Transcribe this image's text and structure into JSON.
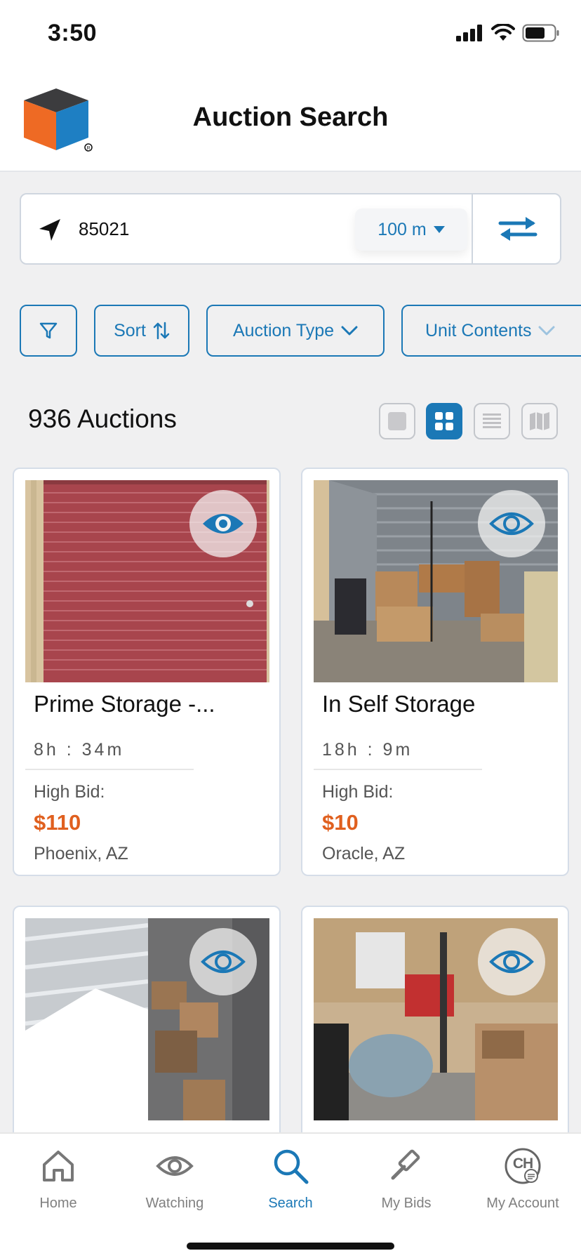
{
  "status_bar": {
    "time": "3:50"
  },
  "header": {
    "title": "Auction Search"
  },
  "location": {
    "zip": "85021",
    "radius": "100 m"
  },
  "filters": {
    "sort_label": "Sort",
    "auction_type_label": "Auction Type",
    "unit_contents_label": "Unit Contents"
  },
  "results": {
    "count_label": "936 Auctions"
  },
  "listings": [
    {
      "name": "Prime Storage -...",
      "time_left": "8h : 34m",
      "bid_label": "High Bid:",
      "bid": "$110",
      "location": "Phoenix, AZ"
    },
    {
      "name": "In Self Storage",
      "time_left": "18h : 9m",
      "bid_label": "High Bid:",
      "bid": "$10",
      "location": "Oracle, AZ"
    },
    {
      "name": "",
      "time_left": "",
      "bid_label": "",
      "bid": "",
      "location": ""
    },
    {
      "name": "",
      "time_left": "",
      "bid_label": "",
      "bid": "",
      "location": ""
    }
  ],
  "tabs": [
    {
      "label": "Home",
      "icon": "home-icon"
    },
    {
      "label": "Watching",
      "icon": "eye-icon"
    },
    {
      "label": "Search",
      "icon": "search-icon"
    },
    {
      "label": "My Bids",
      "icon": "gavel-icon"
    },
    {
      "label": "My Account",
      "icon": "account-icon",
      "initials": "CH"
    }
  ],
  "colors": {
    "accent": "#1b78b6",
    "bid": "#e0601f",
    "logo_orange": "#ee6a24",
    "logo_blue": "#1e7fc3",
    "logo_dark": "#3c3c3e"
  }
}
